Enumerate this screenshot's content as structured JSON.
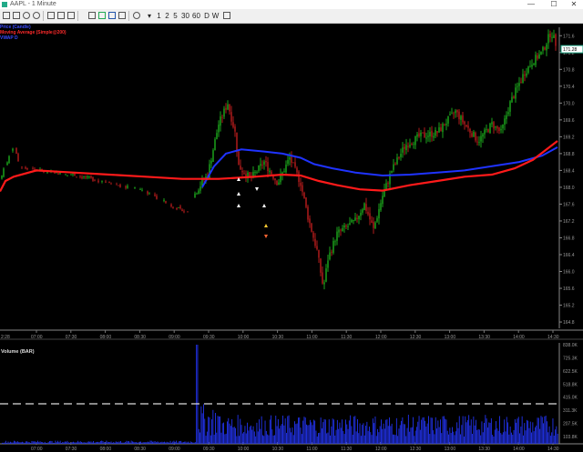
{
  "window": {
    "title": "AAPL - 1 Minute",
    "btn_min": "—",
    "btn_max": "☐",
    "btn_close": "✕"
  },
  "toolbar": {
    "intervals": [
      "1",
      "2",
      "5",
      "30",
      "60",
      "D",
      "W"
    ],
    "icons": [
      "crosshair-icon",
      "pan-icon",
      "zoom-in-icon",
      "zoom-out-icon",
      "text-icon",
      "cursor-icon",
      "indicator-icon",
      "flag-icon",
      "ruler-icon",
      "clock-icon"
    ]
  },
  "legend": {
    "price_label": "Price (Candle)",
    "ma_label": "Moving Average (Simple@200)",
    "vwap_label": "VWAP D"
  },
  "price_axis": {
    "ticks": [
      "171.6",
      "171.2",
      "170.8",
      "170.4",
      "170.0",
      "169.6",
      "169.2",
      "168.8",
      "168.4",
      "168.0",
      "167.6",
      "167.2",
      "166.8",
      "166.4",
      "166.0",
      "165.6",
      "165.2",
      "164.8"
    ],
    "last_price": "171.28"
  },
  "time_axis": {
    "ticks": [
      "07:00",
      "07:30",
      "08:00",
      "08:30",
      "09:00",
      "09:30",
      "10:00",
      "10:30",
      "11:00",
      "11:30",
      "12:00",
      "12:30",
      "13:00",
      "13:30",
      "14:00",
      "14:30"
    ],
    "start_label": "2:28"
  },
  "volume": {
    "label": "Volume (BAR)",
    "ticks": [
      "838.0K",
      "725.3K",
      "622.5K",
      "518.8K",
      "415.0K",
      "311.3K",
      "207.5K",
      "103.8K"
    ]
  },
  "colors": {
    "background": "#000000",
    "ma": "#ff1a1a",
    "vwap": "#1f33ff",
    "up": "#22cc22",
    "down": "#dd2222",
    "volume": "#2233ee"
  }
}
